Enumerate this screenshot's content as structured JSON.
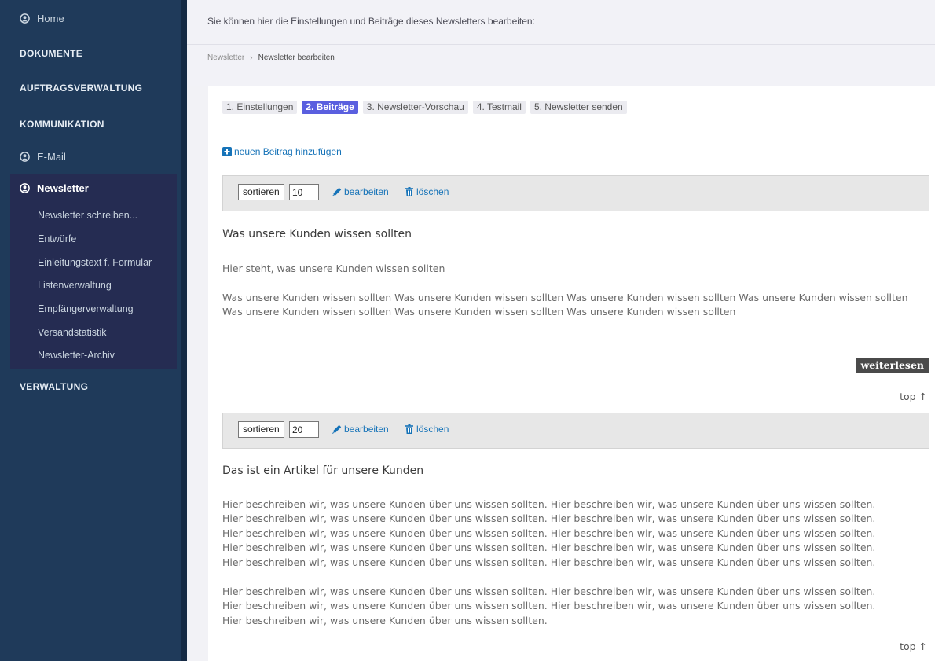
{
  "sidebar": {
    "home": "Home",
    "dokumente": "DOKUMENTE",
    "auftragsverwaltung": "AUFTRAGSVERWALTUNG",
    "kommunikation": "KOMMUNIKATION",
    "email": "E-Mail",
    "newsletter": "Newsletter",
    "sub_items": [
      "Newsletter schreiben...",
      "Entwürfe",
      "Einleitungstext f. Formular",
      "Listenverwaltung",
      "Empfängerverwaltung",
      "Versandstatistik",
      "Newsletter-Archiv"
    ],
    "verwaltung": "VERWALTUNG"
  },
  "header": {
    "intro": "Sie können hier die Einstellungen und Beiträge dieses Newsletters bearbeiten:",
    "breadcrumb": [
      "Newsletter",
      "Newsletter bearbeiten"
    ]
  },
  "tabs": [
    "1. Einstellungen",
    "2. Beiträge",
    "3. Newsletter-Vorschau",
    "4. Testmail",
    "5. Newsletter senden"
  ],
  "active_tab": "2. Beiträge",
  "add_post": "neuen Beitrag hinzufügen",
  "toolbar_labels": {
    "sort": "sortieren",
    "edit": "bearbeiten",
    "delete": "löschen"
  },
  "articles": [
    {
      "order": "10",
      "title": "Was unsere Kunden wissen sollten",
      "lead": "Hier steht, was unsere Kunden wissen sollten",
      "body_lines": [
        "Was unsere Kunden wissen sollten Was unsere Kunden wissen sollten Was unsere Kunden wissen sollten Was unsere Kunden wissen sollten",
        "Was unsere Kunden wissen sollten Was unsere Kunden wissen sollten Was unsere Kunden wissen sollten"
      ],
      "read_more": "weiterlesen",
      "top": "top ↑"
    },
    {
      "order": "20",
      "title": "Das ist ein Artikel für unsere Kunden",
      "para1_lines": [
        "Hier beschreiben wir, was unsere Kunden über uns wissen sollten. Hier beschreiben wir, was unsere Kunden über uns wissen sollten.",
        "Hier beschreiben wir, was unsere Kunden über uns wissen sollten. Hier beschreiben wir, was unsere Kunden über uns wissen sollten.",
        "Hier beschreiben wir, was unsere Kunden über uns wissen sollten. Hier beschreiben wir, was unsere Kunden über uns wissen sollten.",
        "Hier beschreiben wir, was unsere Kunden über uns wissen sollten. Hier beschreiben wir, was unsere Kunden über uns wissen sollten.",
        "Hier beschreiben wir, was unsere Kunden über uns wissen sollten. Hier beschreiben wir, was unsere Kunden über uns wissen sollten."
      ],
      "para2_lines": [
        "Hier beschreiben wir, was unsere Kunden über uns wissen sollten. Hier beschreiben wir, was unsere Kunden über uns wissen sollten.",
        "Hier beschreiben wir, was unsere Kunden über uns wissen sollten. Hier beschreiben wir, was unsere Kunden über uns wissen sollten.",
        "Hier beschreiben wir, was unsere Kunden über uns wissen sollten."
      ],
      "top": "top ↑"
    }
  ],
  "icons": {
    "nav_user": "user-circle-icon",
    "add": "plus-square-icon",
    "edit": "pencil-icon",
    "delete": "trash-icon"
  },
  "colors": {
    "sidebar_bg": "#1f3a5a",
    "sidebar_active": "#252c52",
    "tab_active": "#5a5fdf",
    "link": "#1673b8"
  }
}
